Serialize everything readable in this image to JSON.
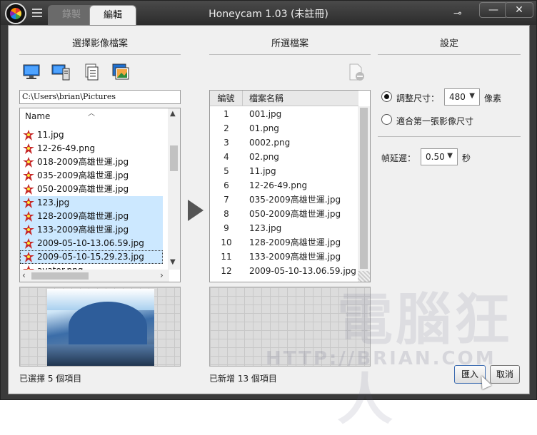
{
  "window": {
    "title": "Honeycam 1.03 (未註冊)",
    "tabs": [
      {
        "label": "錄製",
        "active": false
      },
      {
        "label": "編輯",
        "active": true
      }
    ],
    "minimize_label": "—",
    "close_label": "✕",
    "key_symbol": "⊸"
  },
  "left_panel": {
    "title": "選擇影像檔案",
    "tool_icons": [
      "desktop-icon",
      "computer-icon",
      "documents-icon",
      "pictures-icon"
    ],
    "path": "C:\\Users\\brian\\Pictures",
    "list_header": "Name",
    "files": [
      {
        "name": "11.jpg",
        "selected": false
      },
      {
        "name": "12-26-49.png",
        "selected": false
      },
      {
        "name": "018-2009高雄世運.jpg",
        "selected": false
      },
      {
        "name": "035-2009高雄世運.jpg",
        "selected": false
      },
      {
        "name": "050-2009高雄世運.jpg",
        "selected": false
      },
      {
        "name": "123.jpg",
        "selected": true
      },
      {
        "name": "128-2009高雄世運.jpg",
        "selected": true
      },
      {
        "name": "133-2009高雄世運.jpg",
        "selected": true
      },
      {
        "name": "2009-05-10-13.06.59.jpg",
        "selected": true
      },
      {
        "name": "2009-05-10-15.29.23.jpg",
        "selected": true
      },
      {
        "name": "avator.png",
        "selected": false
      }
    ],
    "status": "已選擇 5 個項目"
  },
  "middle_panel": {
    "title": "所選檔案",
    "col_no": "編號",
    "col_name": "檔案名稱",
    "rows": [
      {
        "no": "1",
        "name": "001.jpg"
      },
      {
        "no": "2",
        "name": "01.png"
      },
      {
        "no": "3",
        "name": "0002.png"
      },
      {
        "no": "4",
        "name": "02.png"
      },
      {
        "no": "5",
        "name": "11.jpg"
      },
      {
        "no": "6",
        "name": "12-26-49.png"
      },
      {
        "no": "7",
        "name": "035-2009高雄世運.jpg"
      },
      {
        "no": "8",
        "name": "050-2009高雄世運.jpg"
      },
      {
        "no": "9",
        "name": "123.jpg"
      },
      {
        "no": "10",
        "name": "128-2009高雄世運.jpg"
      },
      {
        "no": "11",
        "name": "133-2009高雄世運.jpg"
      },
      {
        "no": "12",
        "name": "2009-05-10-13.06.59.jpg"
      }
    ],
    "status": "已新增 13 個項目"
  },
  "settings": {
    "title": "設定",
    "resize_label": "調整尺寸：",
    "resize_value": "480",
    "resize_unit": "像素",
    "resize_selected": true,
    "fit_first_label": "適合第一張影像尺寸",
    "delay_label": "幀延遲：",
    "delay_value": "0.50",
    "delay_unit": "秒"
  },
  "buttons": {
    "import": "匯入",
    "cancel": "取消"
  },
  "watermark": {
    "big": "電腦狂人",
    "url": "HTTP://BRIAN.COM"
  }
}
